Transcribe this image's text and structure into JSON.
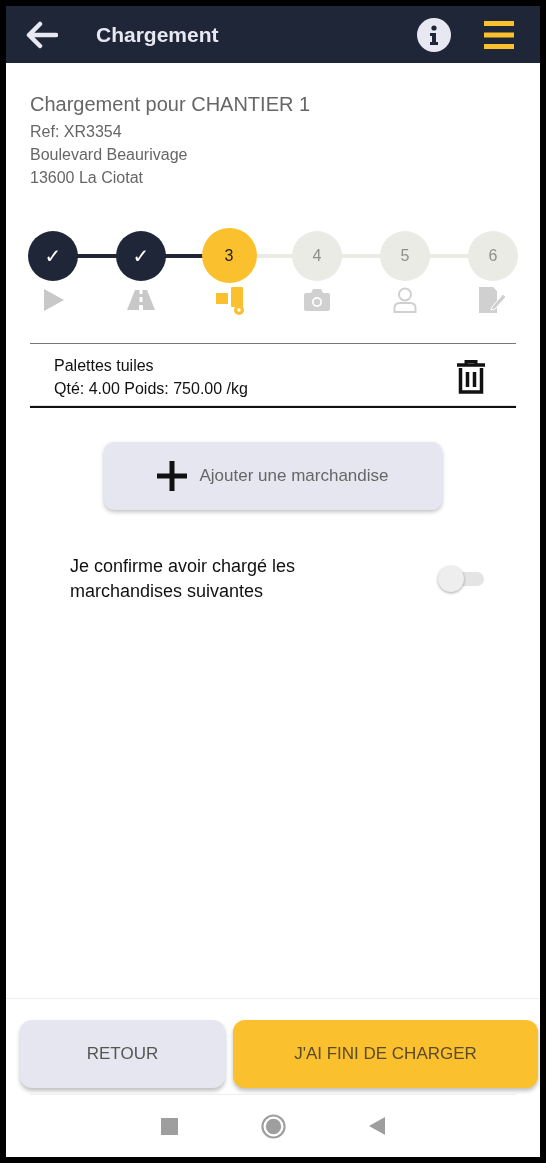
{
  "header": {
    "title": "Chargement"
  },
  "delivery": {
    "title": "Chargement pour CHANTIER 1",
    "ref": "Ref: XR3354",
    "street": "Boulevard Beaurivage",
    "city": "13600 La Ciotat"
  },
  "steps": [
    {
      "label": "✓",
      "done": true,
      "selected": false,
      "kind": "play"
    },
    {
      "label": "✓",
      "done": true,
      "selected": false,
      "kind": "road"
    },
    {
      "label": "3",
      "done": false,
      "selected": true,
      "kind": "loading"
    },
    {
      "label": "4",
      "done": false,
      "selected": false,
      "kind": "camera"
    },
    {
      "label": "5",
      "done": false,
      "selected": false,
      "kind": "user"
    },
    {
      "label": "6",
      "done": false,
      "selected": false,
      "kind": "signature"
    }
  ],
  "items": [
    {
      "name": "Palettes tuiles",
      "details": "Qté: 4.00 Poids: 750.00 /kg"
    }
  ],
  "add_button": {
    "label": "Ajouter une marchandise"
  },
  "confirm": {
    "label": "Je confirme avoir chargé les marchandises suivantes",
    "on": false
  },
  "footer": {
    "back": "RETOUR",
    "done": "J'AI FINI DE CHARGER"
  }
}
